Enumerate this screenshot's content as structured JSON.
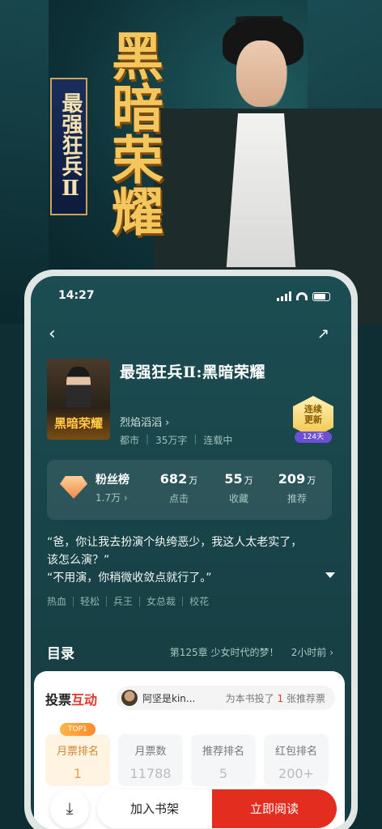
{
  "poster": {
    "subtitle": "最强狂兵Ⅱ",
    "main_title": "黑暗荣耀"
  },
  "status_bar": {
    "time": "14:27"
  },
  "book": {
    "title": "最强狂兵Ⅱ:黑暗荣耀",
    "cover_text": "黑暗荣耀",
    "author": "烈焰滔滔",
    "author_chevron": "›",
    "genre": "都市",
    "word_count": "35万字",
    "status": "连载中"
  },
  "badge": {
    "line1": "连续",
    "line2": "更新",
    "days": "124天"
  },
  "stats": {
    "fans_label": "粉丝榜",
    "fans_value": "1.7万 ›",
    "clicks": {
      "num": "682",
      "unit": "万",
      "label": "点击"
    },
    "favorites": {
      "num": "55",
      "unit": "万",
      "label": "收藏"
    },
    "recommend": {
      "num": "209",
      "unit": "万",
      "label": "推荐"
    }
  },
  "intro": {
    "line1": "“爸，你让我去扮演个纨绔恶少，我这人太老实了，",
    "line2": "该怎么演？”",
    "line3": "“不用演，你稍微收敛点就行了。”"
  },
  "tags": [
    "热血",
    "轻松",
    "兵王",
    "女总裁",
    "校花"
  ],
  "toc": {
    "label": "目录",
    "latest": "第125章 少女时代的梦！",
    "updated": "2小时前 ›"
  },
  "vote": {
    "title_a": "投票",
    "title_b": "互动",
    "voter_name": "阿坚是kin...",
    "msg_pre": "为本书投了",
    "msg_count": "1",
    "msg_post": "张推荐票",
    "top_badge": "TOP1",
    "ranks": [
      {
        "label": "月票排名",
        "value": "1"
      },
      {
        "label": "月票数",
        "value": "11788"
      },
      {
        "label": "推荐排名",
        "value": "5"
      },
      {
        "label": "红包排名",
        "value": "200+"
      }
    ]
  },
  "actions": {
    "download_icon": "⤓",
    "add_shelf": "加入书架",
    "read_now": "立即阅读"
  },
  "icons": {
    "back": "‹",
    "share": "↗"
  }
}
